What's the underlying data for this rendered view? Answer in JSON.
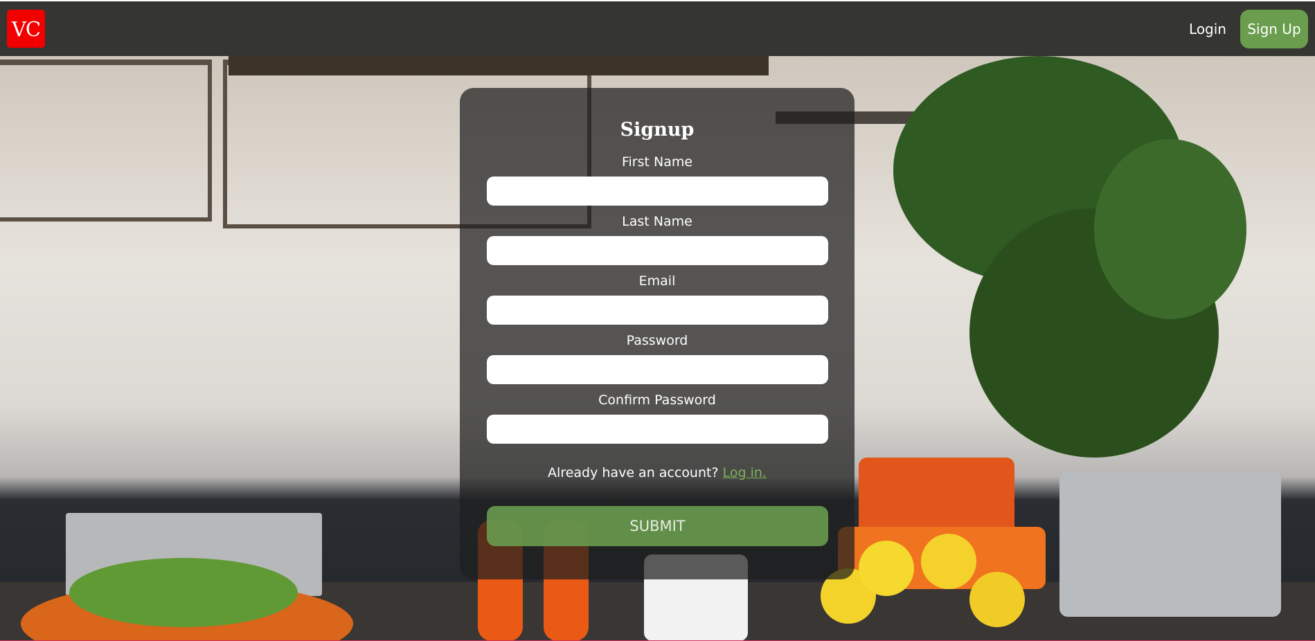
{
  "nav": {
    "logo_text": "VC",
    "login_label": "Login",
    "signup_label": "Sign Up"
  },
  "form": {
    "title": "Signup",
    "fields": [
      {
        "label": "First Name",
        "value": "",
        "placeholder": ""
      },
      {
        "label": "Last Name",
        "value": "",
        "placeholder": ""
      },
      {
        "label": "Email",
        "value": "",
        "placeholder": ""
      },
      {
        "label": "Password",
        "value": "",
        "placeholder": ""
      },
      {
        "label": "Confirm Password",
        "value": "",
        "placeholder": ""
      }
    ],
    "already_text": "Already have an account?",
    "login_link": "Log in.",
    "submit_label": "SUBMIT"
  },
  "colors": {
    "navbar": "#353531",
    "logo_bg": "#f20000",
    "accent_green": "#6a9e4e",
    "link_green": "#7fb35a"
  }
}
